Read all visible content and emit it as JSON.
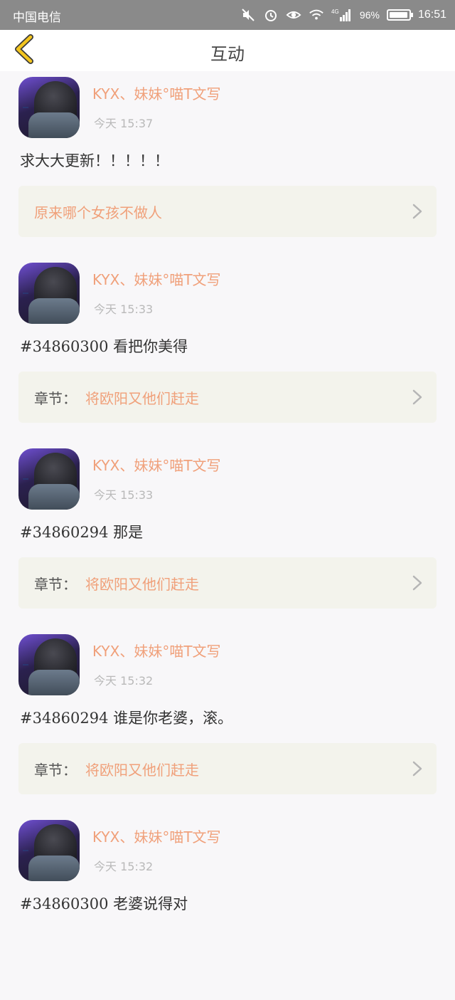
{
  "status_bar": {
    "carrier": "中国电信",
    "network": "4G",
    "battery": "96%",
    "battery_level": 0.96,
    "time": "16:51",
    "icons": [
      "mute-icon",
      "alarm-icon",
      "eye-icon",
      "wifi-icon",
      "signal-icon",
      "battery-icon"
    ]
  },
  "header": {
    "title": "互动",
    "back_icon": "chevron-left-icon"
  },
  "colors": {
    "accent": "#f0a07a",
    "back_arrow": "#f3c51f",
    "ref_bg": "#f3f3ec",
    "page_bg": "#f8f7f9"
  },
  "items": [
    {
      "username": "KYX、妹妹°喵T文写",
      "time": "今天 15:37",
      "comment": "求大大更新！！！！！",
      "ref_prefix": "",
      "ref_text": "原来哪个女孩不做人"
    },
    {
      "username": "KYX、妹妹°喵T文写",
      "time": "今天 15:33",
      "comment": "#34860300 看把你美得",
      "ref_prefix": "章节：",
      "ref_text": "将欧阳又他们赶走"
    },
    {
      "username": "KYX、妹妹°喵T文写",
      "time": "今天 15:33",
      "comment": "#34860294 那是",
      "ref_prefix": "章节：",
      "ref_text": "将欧阳又他们赶走"
    },
    {
      "username": "KYX、妹妹°喵T文写",
      "time": "今天 15:32",
      "comment": "#34860294 谁是你老婆，滚。",
      "ref_prefix": "章节：",
      "ref_text": "将欧阳又他们赶走"
    },
    {
      "username": "KYX、妹妹°喵T文写",
      "time": "今天 15:32",
      "comment": "#34860300 老婆说得对",
      "ref_prefix": "",
      "ref_text": ""
    }
  ]
}
